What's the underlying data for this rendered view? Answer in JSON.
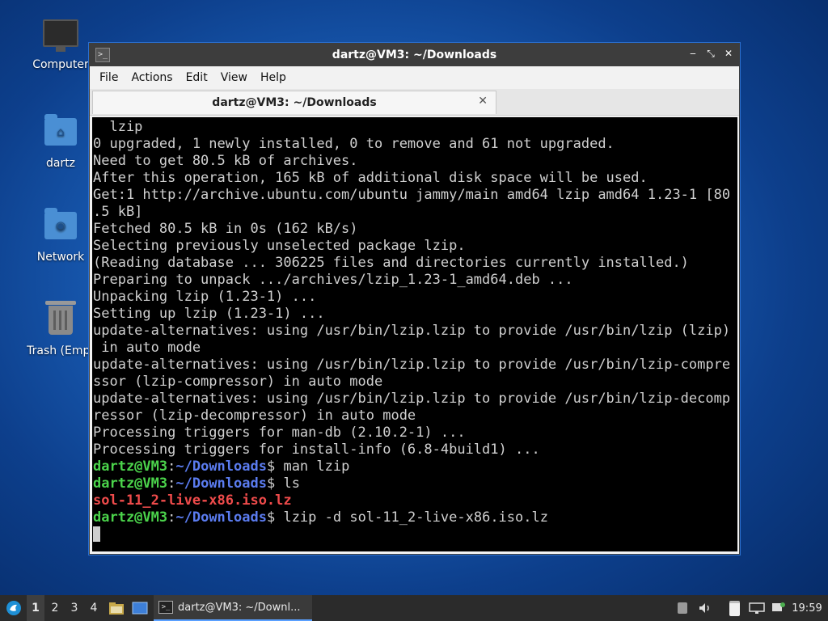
{
  "desktop": {
    "icons": [
      {
        "label": "Computer"
      },
      {
        "label": "dartz"
      },
      {
        "label": "Network"
      },
      {
        "label": "Trash (Empt"
      }
    ]
  },
  "window": {
    "title": "dartz@VM3: ~/Downloads",
    "controls": {
      "minimize": "‒",
      "maximize": "⤡",
      "close": "✕"
    },
    "menu": [
      "File",
      "Actions",
      "Edit",
      "View",
      "Help"
    ],
    "tab": {
      "label": "dartz@VM3: ~/Downloads",
      "close": "✕"
    }
  },
  "terminal": {
    "output_lines": [
      "  lzip",
      "0 upgraded, 1 newly installed, 0 to remove and 61 not upgraded.",
      "Need to get 80.5 kB of archives.",
      "After this operation, 165 kB of additional disk space will be used.",
      "Get:1 http://archive.ubuntu.com/ubuntu jammy/main amd64 lzip amd64 1.23-1 [80",
      ".5 kB]",
      "Fetched 80.5 kB in 0s (162 kB/s)",
      "Selecting previously unselected package lzip.",
      "(Reading database ... 306225 files and directories currently installed.)",
      "Preparing to unpack .../archives/lzip_1.23-1_amd64.deb ...",
      "Unpacking lzip (1.23-1) ...",
      "Setting up lzip (1.23-1) ...",
      "update-alternatives: using /usr/bin/lzip.lzip to provide /usr/bin/lzip (lzip)",
      " in auto mode",
      "update-alternatives: using /usr/bin/lzip.lzip to provide /usr/bin/lzip-compre",
      "ssor (lzip-compressor) in auto mode",
      "update-alternatives: using /usr/bin/lzip.lzip to provide /usr/bin/lzip-decomp",
      "ressor (lzip-decompressor) in auto mode",
      "Processing triggers for man-db (2.10.2-1) ...",
      "Processing triggers for install-info (6.8-4build1) ..."
    ],
    "prompt": {
      "user": "dartz@VM3",
      "sep": ":",
      "path": "~/Downloads",
      "sigil": "$"
    },
    "cmd1": " man lzip",
    "cmd2": " ls",
    "ls_result": "sol-11_2-live-x86.iso.lz",
    "cmd3": " lzip -d sol-11_2-live-x86.iso.lz"
  },
  "taskbar": {
    "workspaces": [
      "1",
      "2",
      "3",
      "4"
    ],
    "active_workspace": "1",
    "task_label": "dartz@VM3: ~/Downl...",
    "clock": "19:59"
  }
}
